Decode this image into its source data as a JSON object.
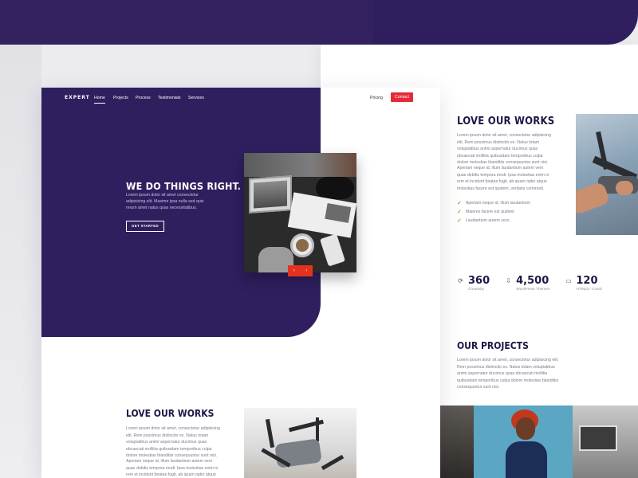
{
  "brand": "EXPERT",
  "nav": {
    "links": [
      "Home",
      "Projects",
      "Process",
      "Testimonials",
      "Services"
    ],
    "pricing": "Pricing",
    "contact": "Contact"
  },
  "hero": {
    "title": "WE DO THINGS RIGHT.",
    "text": "Lorem ipsum dolor sit amet consectetur adipisicing elit. Maxime ipsa nulla sed quis rerum amet natus quas necessitatibus.",
    "cta": "GET STARTED",
    "prev_arrow": "‹",
    "next_arrow": "›"
  },
  "works": {
    "title": "LOVE OUR WORKS",
    "p1": "Lorem ipsum dolor sit amet, consectetur adipisicing elit. Rem possimus distinctio ex. Natus totam voluptatibus animi aspernatur ducimus quas obcaecati mollitia quibusdam temporibus culpa dolore molestias blanditiis consequuntur sunt nisi.",
    "p2": "Aperiam neque id, illum laudantium autem vero quae debitis tempora modi. Ipsa molestias enim in rem et incidunt beatae fugit, ab quam optio atque molestias facere est quidem, veritatis commodi.",
    "checks": [
      "Aperiam neque id, illum laudantium",
      "Maiores facere est quidem",
      "Laudantium autem vero."
    ]
  },
  "stats": [
    {
      "icon": "refresh-icon",
      "value": "360",
      "label": "Creativity"
    },
    {
      "icon": "download-icon",
      "value": "4,500",
      "label": "WordPress Themes"
    },
    {
      "icon": "monitor-icon",
      "value": "120",
      "label": "HTML5 / CSS3"
    }
  ],
  "projects": {
    "title": "OUR PROJECTS",
    "text": "Lorem ipsum dolor sit amet, consectetur adipisicing elit. Rem possimus distinctio ex. Natus totam voluptatibus animi aspernatur ducimus quas obcaecati mollitia quibusdam temporibus culpa dolore molestias blanditiis consequuntur sunt nisi."
  },
  "works2": {
    "title": "LOVE OUR WORKS",
    "p1": "Lorem ipsum dolor sit amet, consectetur adipisicing elit. Rem possimus distinctio ex. Natus totam voluptatibus animi aspernatur ducimus quas obcaecati mollitia quibusdam temporibus culpa dolore molestias blanditiis consequuntur sunt nisi.",
    "p2": "Aperiam neque id, illum laudantium autem vero quae debitis tempora modi. Ipsa molestias enim in rem et incidunt beatae fugit, ab quam optio atque molestias"
  },
  "colors": {
    "purple": "#2f1f5f",
    "navy_text": "#1f1747",
    "red": "#e52a3a",
    "check_green": "#8bb23b"
  }
}
